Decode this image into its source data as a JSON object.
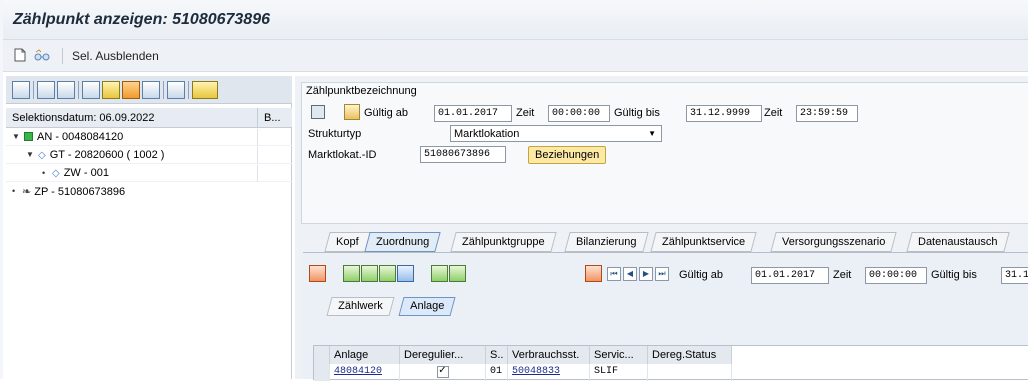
{
  "title": "Zählpunkt anzeigen: 51080673896",
  "appbar": {
    "sel_label": "Sel. Ausblenden",
    "icons": [
      "new-document-icon",
      "glasses-icon"
    ]
  },
  "tree": {
    "header": {
      "col1": "Selektionsdatum: 06.09.2022",
      "col2": "B..."
    },
    "nodes": [
      {
        "label": "AN - 0048084120",
        "icon": "green-square-icon",
        "level": 0,
        "expanded": true
      },
      {
        "label": "GT - 20820600 ( 1002 )",
        "icon": "blue-diamond-icon",
        "level": 1,
        "expanded": true
      },
      {
        "label": "ZW - 001",
        "icon": "blue-diamond-icon",
        "level": 2,
        "expanded": false
      },
      {
        "label": "ZP - 51080673896",
        "icon": "zp-icon",
        "level": 0,
        "expanded": false
      }
    ]
  },
  "detail": {
    "group_title": "Zählpunktbezeichnung",
    "gueltig_ab_label": "Gültig ab",
    "gueltig_ab": "01.01.2017",
    "zeit_label": "Zeit",
    "zeit_ab": "00:00:00",
    "gueltig_bis_label": "Gültig bis",
    "gueltig_bis": "31.12.9999",
    "zeit_bis": "23:59:59",
    "strukturtyp_label": "Strukturtyp",
    "strukturtyp": "Marktlokation",
    "marktlokat_label": "Marktlokat.-ID",
    "marktlokat": "51080673896",
    "beziehungen": "Beziehungen"
  },
  "tabs": [
    "Kopf",
    "Zuordnung",
    "Zählpunktgruppe",
    "Bilanzierung",
    "Zählpunktservice",
    "Versorgungsszenario",
    "Datenaustausch"
  ],
  "active_tab": "Zuordnung",
  "inner": {
    "gueltig_ab_label": "Gültig ab",
    "gueltig_ab": "01.01.2017",
    "zeit_label": "Zeit",
    "zeit": "00:00:00",
    "gueltig_bis_label": "Gültig bis",
    "gueltig_bis_partial": "31.1",
    "subtabs": [
      "Zählwerk",
      "Anlage"
    ],
    "active_subtab": "Anlage"
  },
  "table": {
    "headers": [
      "Anlage",
      "Deregulier...",
      "S..",
      "Verbrauchsst.",
      "Servic...",
      "Dereg.Status"
    ],
    "rows": [
      {
        "anlage": "48084120",
        "dereg": "✓",
        "s": "01",
        "verbrauch": "50048833",
        "servic": "SLIF",
        "status": ""
      }
    ]
  }
}
